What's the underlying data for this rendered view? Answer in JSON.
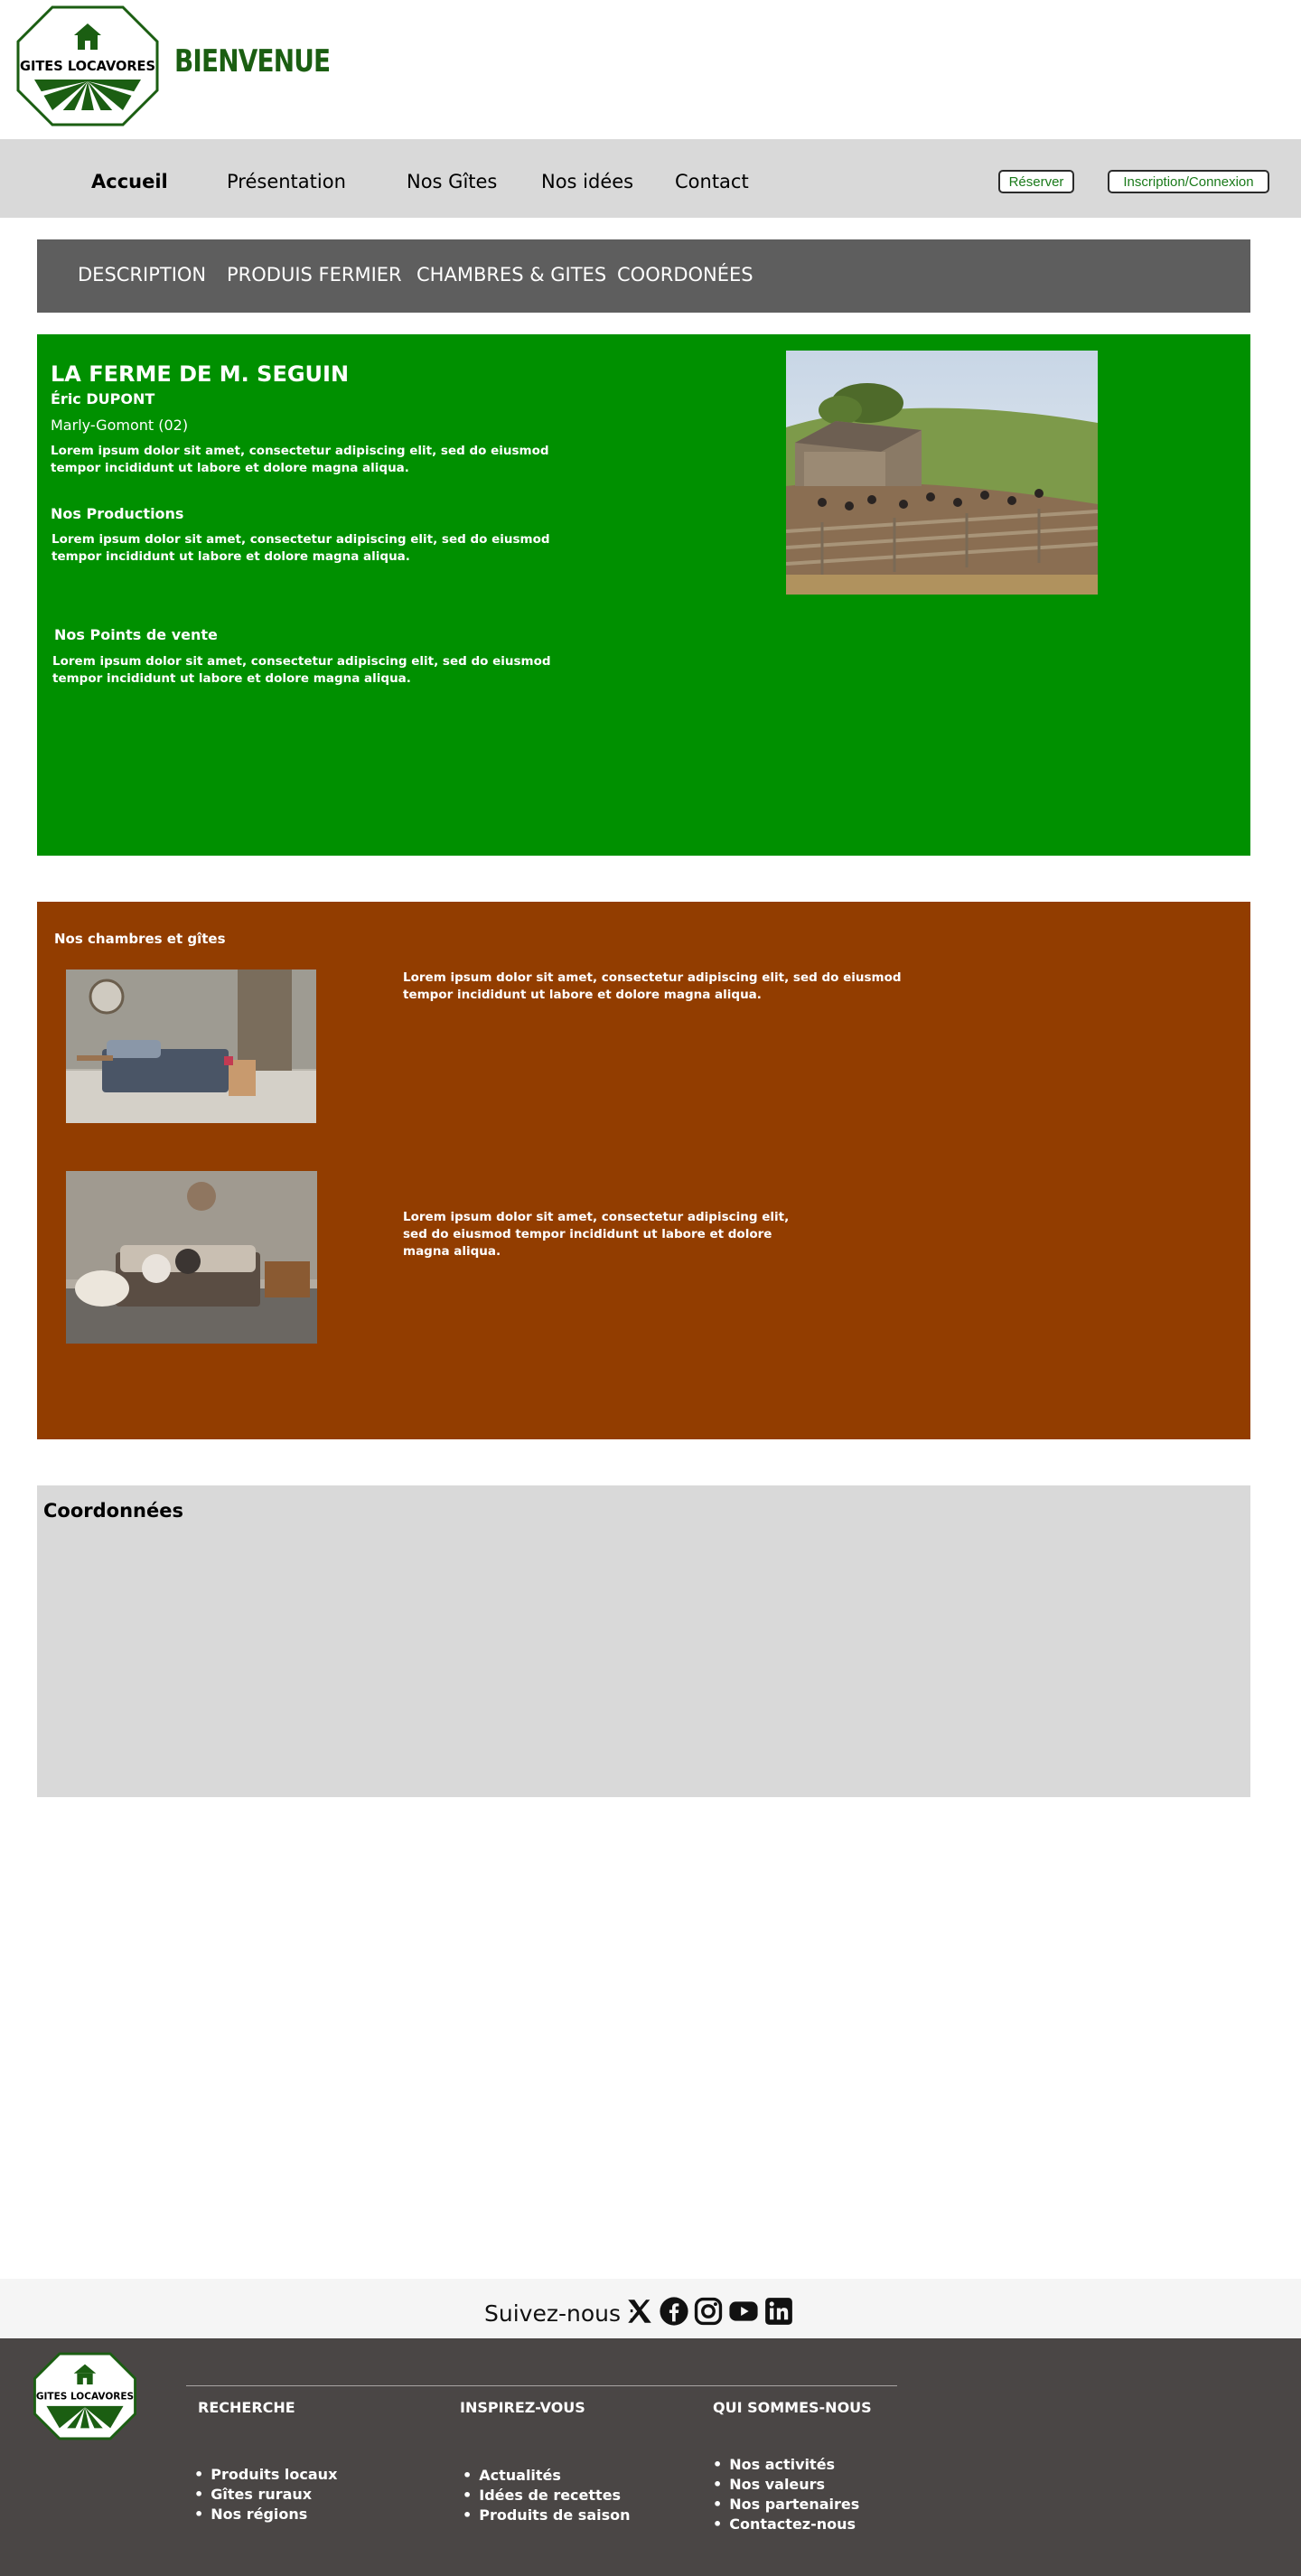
{
  "header": {
    "logo_text": "GITES LOCAVORES",
    "welcome": "BIENVENUE"
  },
  "nav": {
    "items": [
      "Accueil",
      "Présentation",
      "Nos Gîtes",
      "Nos idées",
      "Contact"
    ],
    "reserve_label": "Réserver",
    "login_label": "Inscription/Connexion"
  },
  "tabs": [
    "DESCRIPTION",
    "PRODUIS FERMIER",
    "CHAMBRES & GITES",
    "COORDONÉES"
  ],
  "description": {
    "title": "LA FERME DE M. SEGUIN",
    "owner": "Éric DUPONT",
    "place": "Marly-Gomont (02)",
    "intro": "Lorem ipsum dolor sit amet, consectetur adipiscing elit, sed do eiusmod tempor incididunt ut labore et dolore magna aliqua.",
    "productions_title": "Nos Productions",
    "productions_text": "Lorem ipsum dolor sit amet, consectetur adipiscing elit, sed do eiusmod tempor incididunt ut labore et dolore magna aliqua.",
    "points_title": "Nos Points de vente",
    "points_text": "Lorem ipsum dolor sit amet, consectetur adipiscing elit, sed do eiusmod tempor incididunt ut labore et dolore magna aliqua."
  },
  "rooms": {
    "title": "Nos chambres et gîtes",
    "items": [
      {
        "text": "Lorem ipsum dolor sit amet, consectetur adipiscing elit, sed do eiusmod tempor incididunt ut labore et dolore magna aliqua."
      },
      {
        "text": "Lorem ipsum dolor sit amet, consectetur adipiscing elit, sed do eiusmod tempor incididunt ut labore et dolore magna aliqua."
      }
    ]
  },
  "coords": {
    "title": "Coordonnées"
  },
  "follow": {
    "label": "Suivez-nous :",
    "icons": [
      "x-icon",
      "facebook-icon",
      "instagram-icon",
      "youtube-icon",
      "linkedin-icon"
    ]
  },
  "footer": {
    "columns": [
      {
        "title": "RECHERCHE",
        "items": [
          "Produits locaux",
          "Gîtes ruraux",
          "Nos régions"
        ]
      },
      {
        "title": "INSPIREZ-VOUS",
        "items": [
          "Actualités",
          "Idées de recettes",
          "Produits de saison"
        ]
      },
      {
        "title": "QUI SOMMES-NOUS",
        "items": [
          "Nos activités",
          "Nos valeurs",
          "Nos partenaires",
          "Contactez-nous"
        ]
      }
    ]
  },
  "colors": {
    "brand_green": "#1b5e12",
    "description_bg": "#009000",
    "rooms_bg": "#923d00",
    "tabbar_bg": "#5e5e5e",
    "footer_bg": "#4a4645"
  }
}
